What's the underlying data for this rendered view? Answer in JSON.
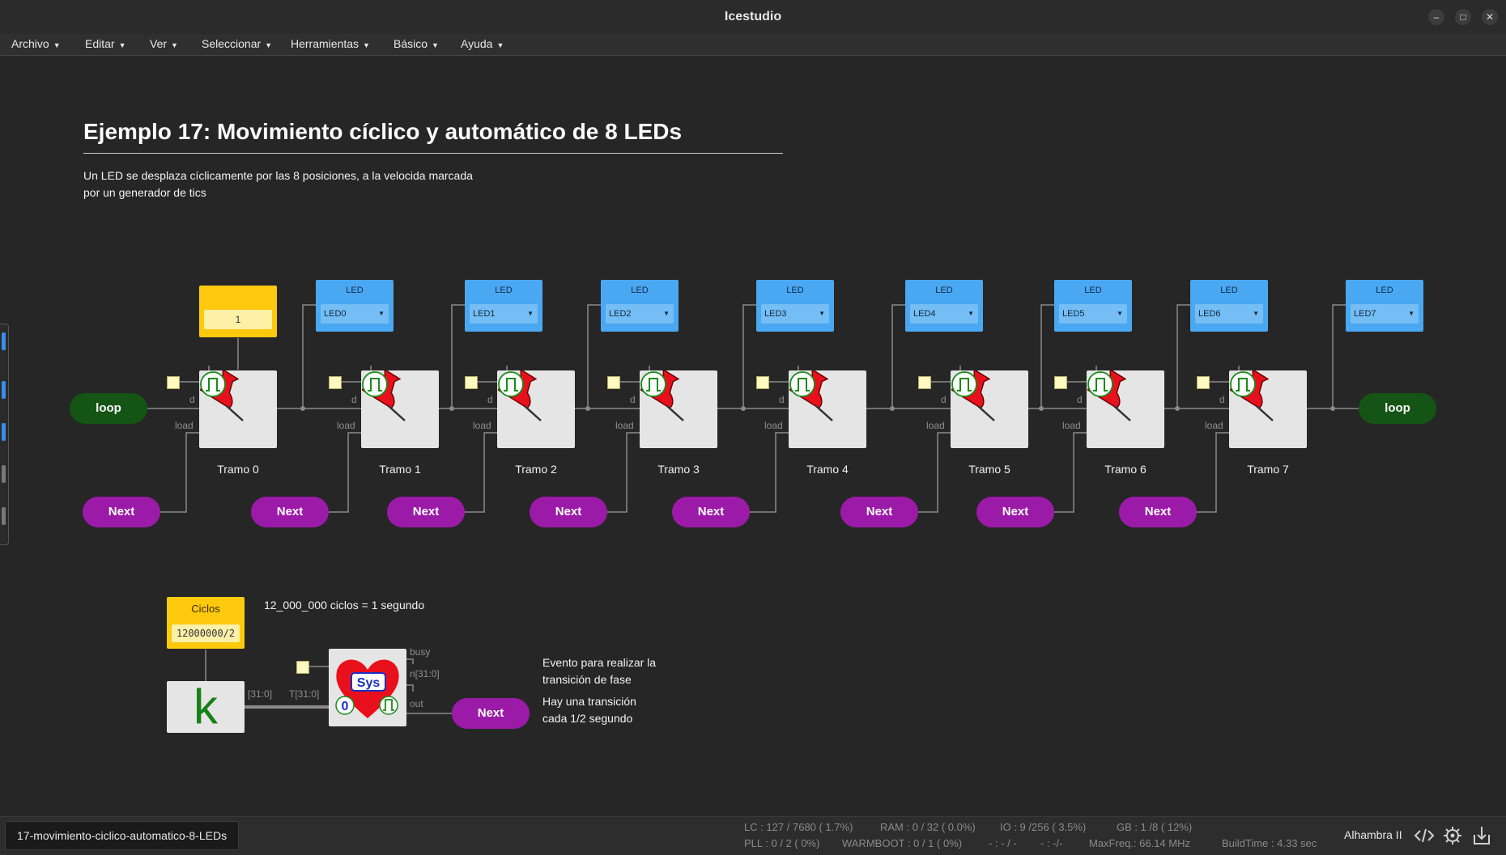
{
  "window": {
    "title": "Icestudio"
  },
  "menu": [
    {
      "label": "Archivo"
    },
    {
      "label": "Editar"
    },
    {
      "label": "Ver"
    },
    {
      "label": "Seleccionar"
    },
    {
      "label": "Herramientas"
    },
    {
      "label": "Básico"
    },
    {
      "label": "Ayuda"
    }
  ],
  "canvas": {
    "heading": "Ejemplo 17: Movimiento cíclico y automático de 8 LEDs",
    "description_line1": "Un LED se desplaza cíclicamente por las 8 posiciones, a la velocida marcada",
    "description_line2": "por un generador de tics",
    "constant_value": "1",
    "loop_label": "loop",
    "next_label": "Next",
    "led_title": "LED",
    "led_dropdown_arrow": "chevron-down-icon",
    "leds": [
      "LED0",
      "LED1",
      "LED2",
      "LED3",
      "LED4",
      "LED5",
      "LED6",
      "LED7"
    ],
    "tramos": [
      "Tramo 0",
      "Tramo 1",
      "Tramo 2",
      "Tramo 3",
      "Tramo 4",
      "Tramo 5",
      "Tramo 6",
      "Tramo 7"
    ],
    "port_d": "d",
    "port_load": "load",
    "ciclos_title": "Ciclos",
    "ciclos_value": "12000000/2",
    "ciclos_note": "12_000_000 ciclos = 1 segundo",
    "k_label": "k",
    "bus_in_label": "[31:0]",
    "bus_t_label": "T[31:0]",
    "sys_label": "Sys",
    "sys_zero": "0",
    "sys_busy": "busy",
    "sys_n": "n[31:0]",
    "sys_out": "out",
    "event_note_line1": "Evento para realizar la",
    "event_note_line2": "transición de fase",
    "transition_note_line1": "Hay una transición",
    "transition_note_line2": "cada 1/2 segundo"
  },
  "colors": {
    "background": "#262626",
    "led_block": "#4aa8f2",
    "constant_block": "#ffc90d",
    "loop_pill": "#145414",
    "next_pill": "#9c1aa8",
    "pin_red": "#e8101c"
  },
  "statusbar": {
    "file_tab": "17-movimiento-ciclico-automatico-8-LEDs",
    "lc": "LC : 127 / 7680 ( 1.7%)",
    "ram": "RAM : 0 / 32 ( 0.0%)",
    "io": "IO : 9 /256 ( 3.5%)",
    "gb": "GB : 1 /8 ( 12%)",
    "pll": "PLL : 0 / 2 ( 0%)",
    "warmboot": "WARMBOOT : 0 / 1 ( 0%)",
    "blank1": "- : - / -",
    "blank2": "- : -/-",
    "maxfreq": "MaxFreq.: 66.14 MHz",
    "buildtime": "BuildTime : 4.33 sec",
    "board": "Alhambra II",
    "icons": [
      "code-icon",
      "settings-gear-icon",
      "download-icon"
    ]
  }
}
